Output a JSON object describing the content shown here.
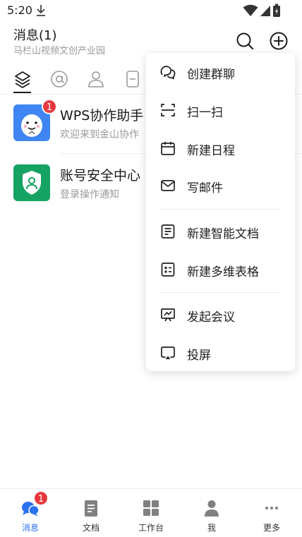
{
  "status_bar": {
    "time": "5:20",
    "icons": [
      "download-icon",
      "wifi-icon",
      "signal-icon",
      "battery-icon"
    ]
  },
  "header": {
    "title": "消息(1)",
    "subtitle": "马栏山视频文创产业园",
    "icons": [
      "search-icon",
      "add-circle-icon"
    ]
  },
  "filter_tabs": [
    "layers-icon",
    "at-icon",
    "person-icon",
    "doc-icon"
  ],
  "messages": [
    {
      "title": "WPS协作助手",
      "preview": "欢迎来到金山协作",
      "badge": "1",
      "avatar_icon": "wps-assistant-avatar",
      "avatar_color": "#3f86f4"
    },
    {
      "title": "账号安全中心",
      "preview": "登录操作通知",
      "avatar_icon": "shield-user-icon",
      "avatar_color": "#16a263"
    }
  ],
  "menu": {
    "items": [
      {
        "label": "创建群聊",
        "icon": "group-chat-icon"
      },
      {
        "label": "扫一扫",
        "icon": "scan-icon"
      },
      {
        "label": "新建日程",
        "icon": "calendar-icon"
      },
      {
        "label": "写邮件",
        "icon": "mail-icon"
      },
      {
        "label": "新建智能文档",
        "icon": "smart-doc-icon"
      },
      {
        "label": "新建多维表格",
        "icon": "table-icon"
      },
      {
        "label": "发起会议",
        "icon": "meeting-icon"
      },
      {
        "label": "投屏",
        "icon": "cast-icon"
      }
    ]
  },
  "bottom_nav": {
    "items": [
      {
        "label": "消息",
        "icon": "chat-bubble-icon",
        "badge": "1",
        "active": true
      },
      {
        "label": "文档",
        "icon": "document-icon"
      },
      {
        "label": "工作台",
        "icon": "grid-icon"
      },
      {
        "label": "我",
        "icon": "person-icon"
      },
      {
        "label": "更多",
        "icon": "more-icon"
      }
    ]
  },
  "colors": {
    "accent": "#2a72f0",
    "badge": "#e8383d",
    "text_primary": "#1a1a1a",
    "text_secondary": "#9a9a9a"
  }
}
